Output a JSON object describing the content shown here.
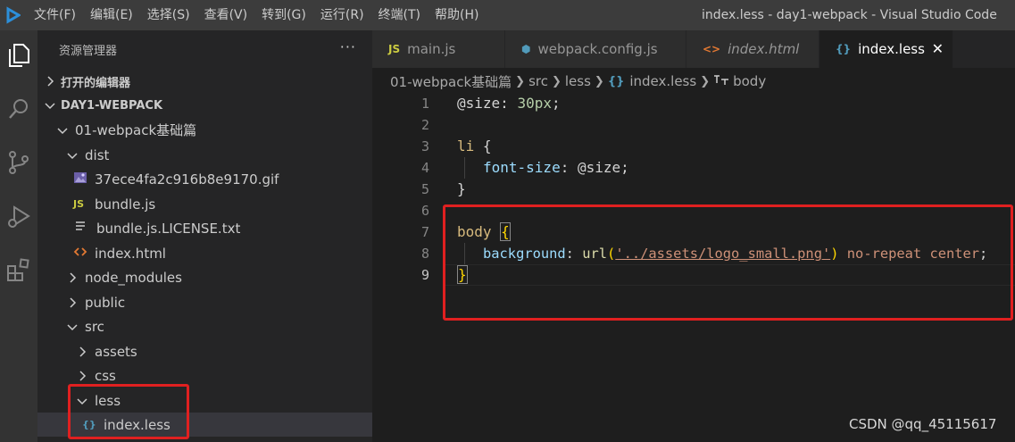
{
  "window": {
    "title": "index.less - day1-webpack - Visual Studio Code",
    "menu": [
      "文件(F)",
      "编辑(E)",
      "选择(S)",
      "查看(V)",
      "转到(G)",
      "运行(R)",
      "终端(T)",
      "帮助(H)"
    ]
  },
  "sidebar": {
    "header": "资源管理器",
    "more": "···",
    "open_editors": "打开的编辑器",
    "workspace": "DAY1-WEBPACK",
    "tree": [
      {
        "label": "01-webpack基础篇",
        "icon": "chevron-down"
      },
      {
        "label": "dist",
        "icon": "chevron-down"
      },
      {
        "label": "37ece4fa2c916b8e9170.gif",
        "icon": "image-file"
      },
      {
        "label": "bundle.js",
        "icon": "js-file",
        "badge": "JS"
      },
      {
        "label": "bundle.js.LICENSE.txt",
        "icon": "text-file"
      },
      {
        "label": "index.html",
        "icon": "html-file"
      },
      {
        "label": "node_modules",
        "icon": "chevron-right"
      },
      {
        "label": "public",
        "icon": "chevron-right"
      },
      {
        "label": "src",
        "icon": "chevron-down"
      },
      {
        "label": "assets",
        "icon": "chevron-right"
      },
      {
        "label": "css",
        "icon": "chevron-right"
      },
      {
        "label": "less",
        "icon": "chevron-down"
      },
      {
        "label": "index.less",
        "icon": "less-file",
        "badge": "{}"
      }
    ]
  },
  "tabs": [
    {
      "label": "main.js",
      "badge": "JS",
      "color": "#cbcb41"
    },
    {
      "label": "webpack.config.js",
      "badge": "⬢",
      "color": "#519aba"
    },
    {
      "label": "index.html",
      "badge": "<>",
      "color": "#e37933"
    },
    {
      "label": "index.less",
      "badge": "{}",
      "color": "#519aba",
      "close": "✕"
    }
  ],
  "breadcrumb": [
    "01-webpack基础篇",
    "src",
    "less",
    "index.less",
    "body"
  ],
  "breadcrumb_icons": {
    "less_file": "{}"
  },
  "editor": {
    "line_numbers": [
      "1",
      "2",
      "3",
      "4",
      "5",
      "6",
      "7",
      "8",
      "9"
    ],
    "code": {
      "l1_var": "@size",
      "l1_colon": ": ",
      "l1_num": "30px",
      "l1_semi": ";",
      "l3_sel": "li ",
      "l3_brace": "{",
      "l4_prop": "font-size",
      "l4_colon": ": ",
      "l4_val": "@size",
      "l4_semi": ";",
      "l5_brace": "}",
      "l7_sel": "body ",
      "l7_brace": "{",
      "l8_prop": "background",
      "l8_colon": ": ",
      "l8_fn": "url",
      "l8_paren_open": "(",
      "l8_str": "'../assets/logo_small.png'",
      "l8_paren_close": ")",
      "l8_rest": " no-repeat center",
      "l8_semi": ";",
      "l9_brace": "}"
    }
  },
  "watermark": "CSDN @qq_45115617",
  "colors": {
    "annotation_red": "#e02020",
    "accent_blue": "#007acc"
  }
}
